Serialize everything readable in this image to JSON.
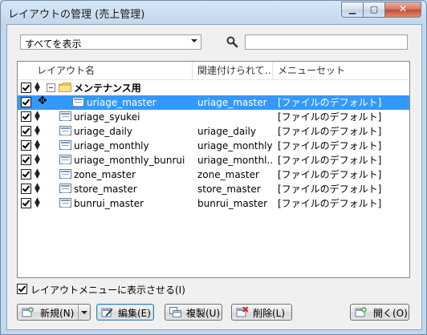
{
  "window": {
    "title": "レイアウトの管理 (売上管理)",
    "minimize_glyph": "▁",
    "maximize_glyph": "▢",
    "close_glyph": "✕"
  },
  "filter": {
    "selected": "すべてを表示",
    "icon": "search-icon",
    "search_value": ""
  },
  "columns": [
    "レイアウト名",
    "関連付けられて…",
    "メニューセット"
  ],
  "group": {
    "label": "メンテナンス用",
    "checked": true,
    "expanded": true
  },
  "rows": [
    {
      "name": "uriage_master",
      "related": "uriage_master",
      "menu": "[ファイルのデフォルト]",
      "checked": true,
      "selected": true,
      "in_group": true
    },
    {
      "name": "uriage_syukei",
      "related": "",
      "menu": "[ファイルのデフォルト]",
      "checked": true,
      "selected": false,
      "in_group": false
    },
    {
      "name": "uriage_daily",
      "related": "uriage_daily",
      "menu": "[ファイルのデフォルト]",
      "checked": true,
      "selected": false,
      "in_group": false
    },
    {
      "name": "uriage_monthly",
      "related": "uriage_monthly",
      "menu": "[ファイルのデフォルト]",
      "checked": true,
      "selected": false,
      "in_group": false
    },
    {
      "name": "uriage_monthly_bunrui",
      "related": "uriage_monthl...",
      "menu": "[ファイルのデフォルト]",
      "checked": true,
      "selected": false,
      "in_group": false
    },
    {
      "name": "zone_master",
      "related": "zone_master",
      "menu": "[ファイルのデフォルト]",
      "checked": true,
      "selected": false,
      "in_group": false
    },
    {
      "name": "store_master",
      "related": "store_master",
      "menu": "[ファイルのデフォルト]",
      "checked": true,
      "selected": false,
      "in_group": false
    },
    {
      "name": "bunrui_master",
      "related": "bunrui_master",
      "menu": "[ファイルのデフォルト]",
      "checked": true,
      "selected": false,
      "in_group": false
    }
  ],
  "show_in_menu": {
    "label": "レイアウトメニューに表示させる(I)",
    "checked": true
  },
  "buttons": {
    "new": "新規(N)",
    "edit": "編集(E)",
    "duplicate": "複製(U)",
    "delete": "削除(L)",
    "open": "開く(O)"
  },
  "colors": {
    "selection": "#3399ff",
    "close_button": "#c44a30"
  }
}
